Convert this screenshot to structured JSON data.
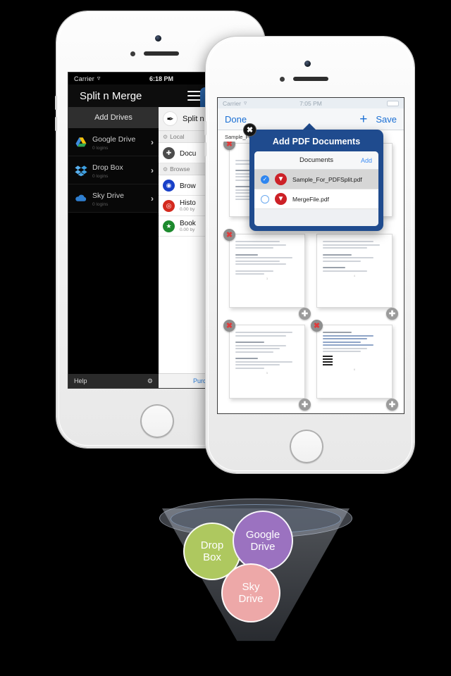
{
  "phone1": {
    "status": {
      "carrier": "Carrier",
      "wifi_icon": "wifi-icon",
      "time": "6:18 PM"
    },
    "navbar": {
      "title": "Split n Merge",
      "menu_icon": "hamburger-menu-icon",
      "tab_label": "D",
      "tab_icon": "document-tab-icon"
    },
    "sidebar": {
      "header": "Add Drives",
      "items": [
        {
          "name": "Google Drive",
          "sub": "0 logins",
          "icon": "google-drive-icon",
          "chevron": "›"
        },
        {
          "name": "Drop Box",
          "sub": "0 logins",
          "icon": "dropbox-icon",
          "chevron": "›"
        },
        {
          "name": "Sky Drive",
          "sub": "0 logins",
          "icon": "skydrive-icon",
          "chevron": "›"
        }
      ],
      "footer": {
        "help": "Help",
        "settings_icon": "gear-icon"
      }
    },
    "content": {
      "app_title": "Split n ",
      "app_icon": "split-merge-app-icon",
      "sections": [
        {
          "label": "Local"
        },
        {
          "label": "Browse"
        }
      ],
      "local_items": [
        {
          "name": "Docu",
          "icon": "documents-folder-icon",
          "sub": ""
        }
      ],
      "browse_items": [
        {
          "name": "Brow",
          "icon": "browser-icon",
          "sub": ""
        },
        {
          "name": "Histo",
          "icon": "history-icon",
          "sub": "0.00 by"
        },
        {
          "name": "Book",
          "icon": "bookmarks-icon",
          "sub": "0.00 by"
        }
      ],
      "purchase": "Purchase"
    }
  },
  "phone2": {
    "status": {
      "carrier": "Carrier",
      "wifi_icon": "wifi-icon",
      "time": "7:05 PM",
      "battery_icon": "battery-icon"
    },
    "navbar": {
      "done": "Done",
      "plus": "+",
      "save": "Save"
    },
    "document_label": "Sample_For",
    "pages": [
      {
        "id": "page-1",
        "delete": true,
        "add": false
      },
      {
        "id": "page-2",
        "delete": false,
        "add": false
      },
      {
        "id": "page-3",
        "delete": true,
        "add": true
      },
      {
        "id": "page-4",
        "delete": false,
        "add": true
      },
      {
        "id": "page-5",
        "delete": true,
        "add": true
      },
      {
        "id": "page-6",
        "delete": true,
        "add": true
      }
    ],
    "badges": {
      "delete_glyph": "✖",
      "add_glyph": "✚"
    },
    "modal": {
      "title": "Add PDF Documents",
      "close_glyph": "✖",
      "panel_header": "Documents",
      "add_label": "Add",
      "files": [
        {
          "name": "Sample_For_PDFSplit.pdf",
          "selected": true,
          "icon": "pdf-file-icon",
          "check_glyph": "✓"
        },
        {
          "name": "MergeFile.pdf",
          "selected": false,
          "icon": "pdf-file-icon",
          "check_glyph": ""
        }
      ]
    }
  },
  "funnel": {
    "bubbles": [
      {
        "id": "drop",
        "line1": "Drop",
        "line2": "Box",
        "color": "#aec85f"
      },
      {
        "id": "google",
        "line1": "Google",
        "line2": "Drive",
        "color": "#9b72c0"
      },
      {
        "id": "sky",
        "line1": "Sky",
        "line2": "Drive",
        "color": "#eda8a8"
      }
    ]
  }
}
